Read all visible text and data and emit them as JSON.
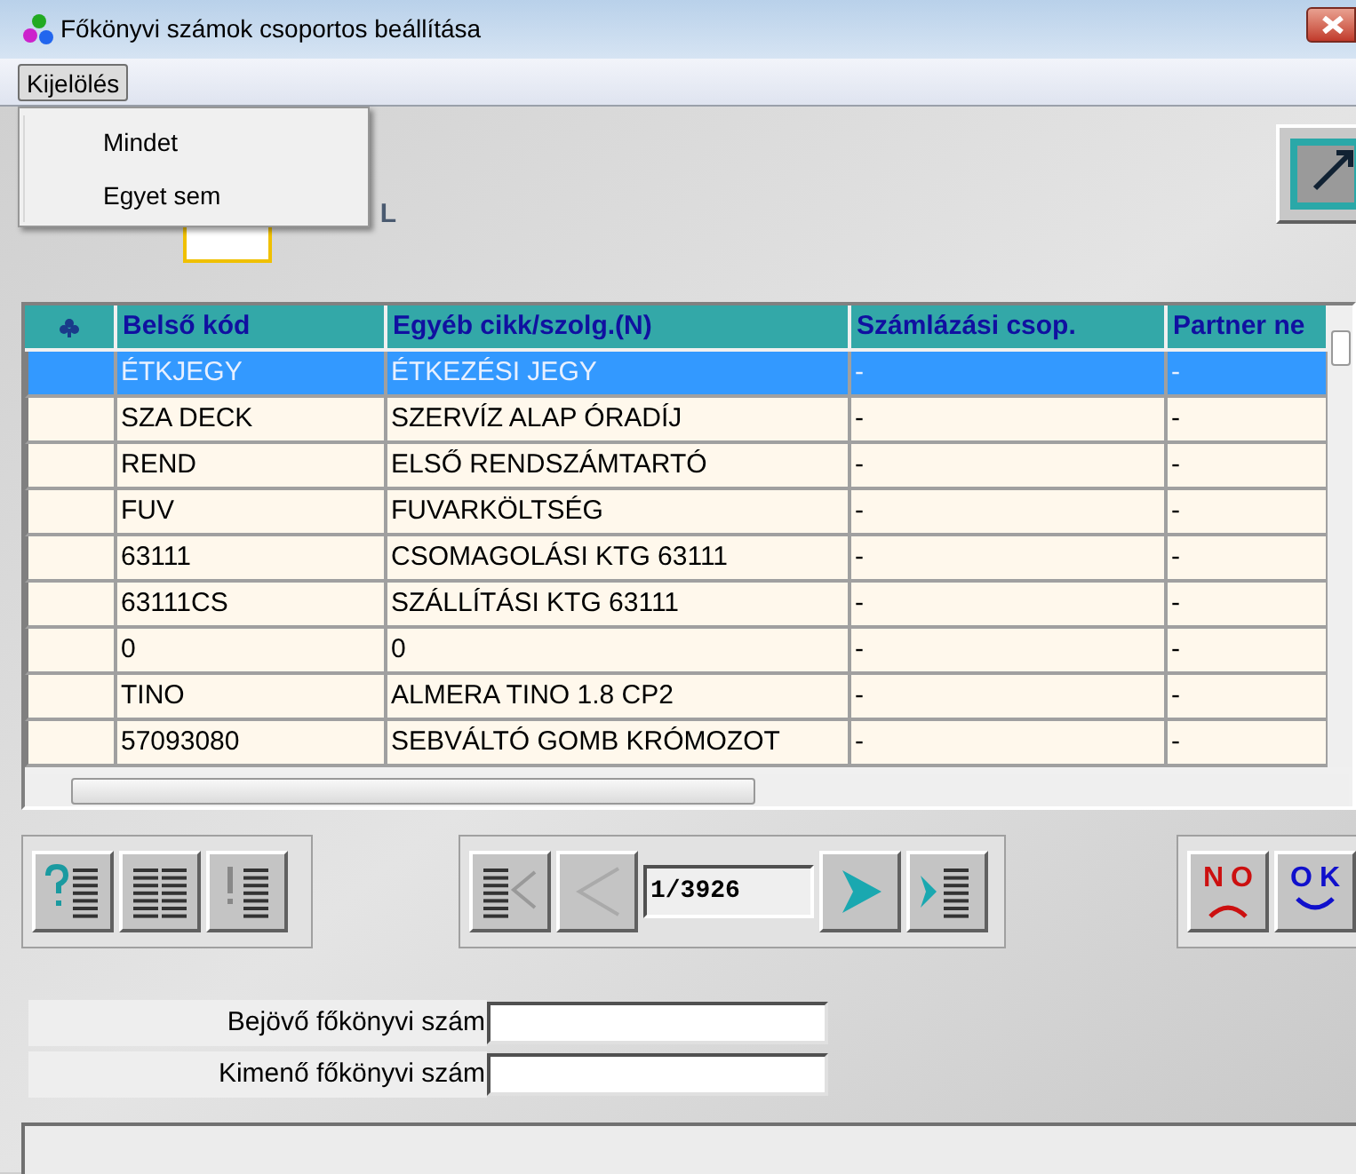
{
  "window": {
    "title": "Főkönyvi számok csoportos beállítása"
  },
  "menu": {
    "items": [
      {
        "label": "Kijelölés",
        "expanded": true
      }
    ],
    "dropdown": [
      {
        "label": "Mindet"
      },
      {
        "label": "Egyet sem"
      }
    ]
  },
  "logo": {
    "text": "L"
  },
  "grid": {
    "columns": [
      "Belső kód",
      "Egyéb cikk/szolg.(N)",
      "Számlázási csop.",
      "Partner ne"
    ],
    "rows": [
      {
        "cells": [
          "ÉTKJEGY",
          "ÉTKEZÉSI JEGY",
          "-",
          "-"
        ],
        "selected": true
      },
      {
        "cells": [
          "SZA DECK",
          "SZERVÍZ ALAP ÓRADÍJ",
          "-",
          "-"
        ],
        "selected": false
      },
      {
        "cells": [
          "REND",
          "ELSŐ RENDSZÁMTARTÓ",
          "-",
          "-"
        ],
        "selected": false
      },
      {
        "cells": [
          "FUV",
          "FUVARKÖLTSÉG",
          "-",
          "-"
        ],
        "selected": false
      },
      {
        "cells": [
          "63111",
          "CSOMAGOLÁSI KTG 63111",
          "-",
          "-"
        ],
        "selected": false
      },
      {
        "cells": [
          "63111CS",
          "SZÁLLÍTÁSI KTG 63111",
          "-",
          "-"
        ],
        "selected": false
      },
      {
        "cells": [
          "0",
          "0",
          "-",
          "-"
        ],
        "selected": false
      },
      {
        "cells": [
          "TINO",
          "ALMERA TINO 1.8 CP2",
          "-",
          "-"
        ],
        "selected": false
      },
      {
        "cells": [
          "57093080",
          "SEBVÁLTÓ GOMB KRÓMOZOT",
          "-",
          "-"
        ],
        "selected": false
      }
    ]
  },
  "pager": {
    "position": "1/3926"
  },
  "dialog_buttons": [
    {
      "kind": "no",
      "label": "NO"
    },
    {
      "kind": "ok",
      "label": "OK"
    }
  ],
  "form": [
    {
      "label": "Bejövő főkönyvi szám"
    },
    {
      "label": "Kimenő főkönyvi szám"
    }
  ]
}
